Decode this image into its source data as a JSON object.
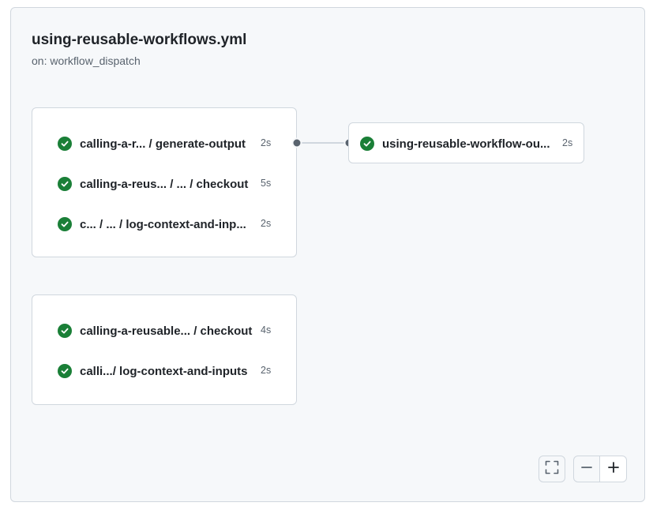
{
  "workflow": {
    "title": "using-reusable-workflows.yml",
    "trigger": "on: workflow_dispatch"
  },
  "groups": [
    {
      "jobs": [
        {
          "name": "calling-a-r... / generate-output",
          "duration": "2s",
          "status": "success"
        },
        {
          "name": "calling-a-reus...  / ... / checkout",
          "duration": "5s",
          "status": "success"
        },
        {
          "name": "c... / ... / log-context-and-inp...",
          "duration": "2s",
          "status": "success"
        }
      ]
    },
    {
      "jobs": [
        {
          "name": "calling-a-reusable... / checkout",
          "duration": "4s",
          "status": "success"
        },
        {
          "name": "calli.../ log-context-and-inputs",
          "duration": "2s",
          "status": "success"
        }
      ]
    }
  ],
  "downstream_job": {
    "name": "using-reusable-workflow-ou...",
    "duration": "2s",
    "status": "success"
  },
  "controls": {
    "fullscreen_icon": "fullscreen-icon",
    "zoom_out_icon": "minus-icon",
    "zoom_in_icon": "plus-icon"
  },
  "colors": {
    "success": "#1a7f37",
    "panel_bg": "#f6f8fa",
    "border": "#d0d7de",
    "connector_dot": "#59636e"
  }
}
